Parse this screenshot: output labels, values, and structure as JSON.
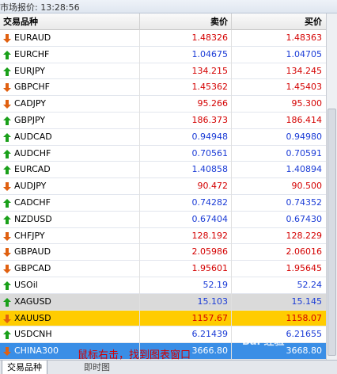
{
  "window": {
    "title": "市场报价: 13:28:56"
  },
  "table": {
    "columns": {
      "symbol": "交易品种",
      "bid": "卖价",
      "ask": "买价"
    },
    "rows": [
      {
        "symbol": "EURAUD",
        "direction": "down",
        "bid": "1.48326",
        "ask": "1.48363",
        "color": "#d40000"
      },
      {
        "symbol": "EURCHF",
        "direction": "up",
        "bid": "1.04675",
        "ask": "1.04705",
        "color": "#1a3bd6"
      },
      {
        "symbol": "EURJPY",
        "direction": "up",
        "bid": "134.215",
        "ask": "134.245",
        "color": "#d40000"
      },
      {
        "symbol": "GBPCHF",
        "direction": "down",
        "bid": "1.45362",
        "ask": "1.45403",
        "color": "#d40000"
      },
      {
        "symbol": "CADJPY",
        "direction": "down",
        "bid": "95.266",
        "ask": "95.300",
        "color": "#d40000"
      },
      {
        "symbol": "GBPJPY",
        "direction": "up",
        "bid": "186.373",
        "ask": "186.414",
        "color": "#d40000"
      },
      {
        "symbol": "AUDCAD",
        "direction": "up",
        "bid": "0.94948",
        "ask": "0.94980",
        "color": "#1a3bd6"
      },
      {
        "symbol": "AUDCHF",
        "direction": "up",
        "bid": "0.70561",
        "ask": "0.70591",
        "color": "#1a3bd6"
      },
      {
        "symbol": "EURCAD",
        "direction": "up",
        "bid": "1.40858",
        "ask": "1.40894",
        "color": "#1a3bd6"
      },
      {
        "symbol": "AUDJPY",
        "direction": "down",
        "bid": "90.472",
        "ask": "90.500",
        "color": "#d40000"
      },
      {
        "symbol": "CADCHF",
        "direction": "up",
        "bid": "0.74282",
        "ask": "0.74352",
        "color": "#1a3bd6"
      },
      {
        "symbol": "NZDUSD",
        "direction": "up",
        "bid": "0.67404",
        "ask": "0.67430",
        "color": "#1a3bd6"
      },
      {
        "symbol": "CHFJPY",
        "direction": "down",
        "bid": "128.192",
        "ask": "128.229",
        "color": "#d40000"
      },
      {
        "symbol": "GBPAUD",
        "direction": "down",
        "bid": "2.05986",
        "ask": "2.06016",
        "color": "#d40000"
      },
      {
        "symbol": "GBPCAD",
        "direction": "down",
        "bid": "1.95601",
        "ask": "1.95645",
        "color": "#d40000"
      },
      {
        "symbol": "USOil",
        "direction": "up",
        "bid": "52.19",
        "ask": "52.24",
        "color": "#1a3bd6"
      },
      {
        "symbol": "XAGUSD",
        "direction": "up",
        "bid": "15.103",
        "ask": "15.145",
        "color": "#1a3bd6",
        "highlight": "gray"
      },
      {
        "symbol": "XAUUSD",
        "direction": "down",
        "bid": "1157.67",
        "ask": "1158.07",
        "color": "#d40000",
        "highlight": "gold"
      },
      {
        "symbol": "USDCNH",
        "direction": "up",
        "bid": "6.21439",
        "ask": "6.21655",
        "color": "#1a3bd6"
      },
      {
        "symbol": "CHINA300",
        "direction": "down",
        "bid": "3666.80",
        "ask": "3668.80",
        "color": "#ffffff",
        "highlight": "blue"
      }
    ]
  },
  "annotation": {
    "text": "鼠标右击，找到图表窗口"
  },
  "watermark": {
    "text": "Bai 经验"
  },
  "tabs": [
    {
      "label": "交易品种",
      "active": true
    },
    {
      "label": "即时图",
      "active": false
    }
  ],
  "colors": {
    "up_arrow": "#1aa01a",
    "down_arrow": "#e06010",
    "bid_red": "#d40000",
    "bid_blue": "#1a3bd6"
  }
}
